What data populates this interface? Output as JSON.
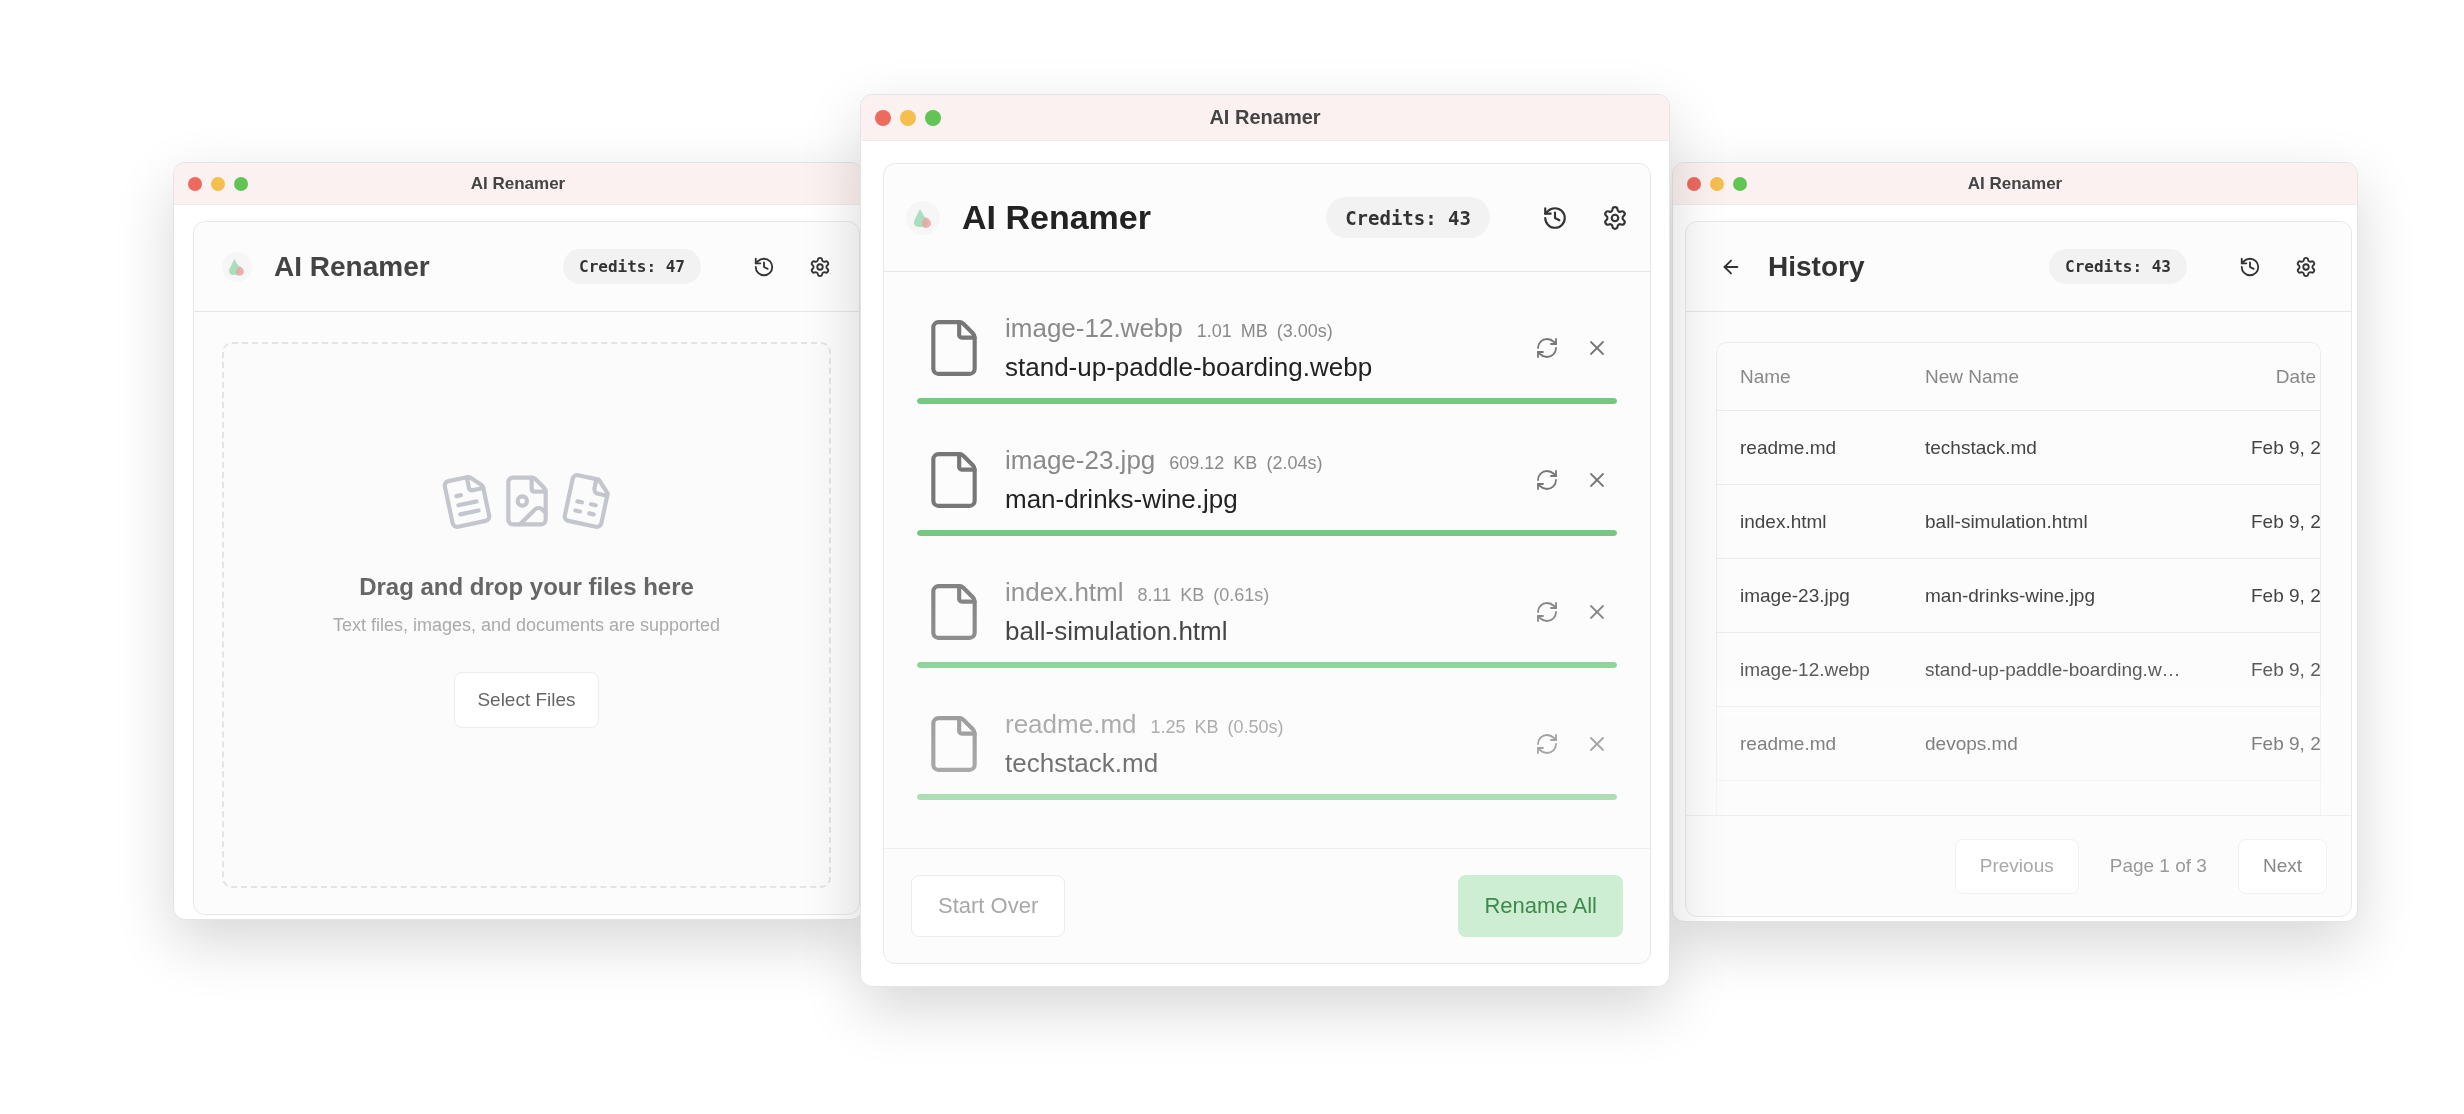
{
  "windows": [
    {
      "kind": "upload",
      "title": "AI Renamer",
      "app_name": "AI Renamer",
      "credits": "Credits: 47",
      "dropzone": {
        "heading": "Drag and drop your files here",
        "subtext": "Text files, images, and documents are supported",
        "button": "Select Files"
      }
    },
    {
      "kind": "rename",
      "title": "AI Renamer",
      "app_name": "AI Renamer",
      "credits": "Credits: 43",
      "files": [
        {
          "original": "image-12.webp",
          "meta": "1.01 MB (3.00s)",
          "new_name": "stand-up-paddle-boarding.webp",
          "level": 1
        },
        {
          "original": "image-23.jpg",
          "meta": "609.12 KB (2.04s)",
          "new_name": "man-drinks-wine.jpg",
          "level": 1
        },
        {
          "original": "index.html",
          "meta": "8.11 KB (0.61s)",
          "new_name": "ball-simulation.html",
          "level": 1
        },
        {
          "original": "readme.md",
          "meta": "1.25 KB (0.50s)",
          "new_name": "techstack.md",
          "level": 1
        }
      ],
      "buttons": [
        {
          "kind": "secondary",
          "label": "Start Over",
          "disabled": true
        },
        {
          "kind": "primary",
          "label": "Rename All",
          "disabled": true
        }
      ]
    },
    {
      "kind": "history",
      "title": "AI Renamer",
      "page_title": "History",
      "credits": "Credits: 43",
      "table": {
        "columns": [
          "Name",
          "New Name",
          "Date"
        ],
        "rows": [
          [
            "readme.md",
            "techstack.md",
            "Feb 9, 2"
          ],
          [
            "index.html",
            "ball-simulation.html",
            "Feb 9, 2"
          ],
          [
            "image-23.jpg",
            "man-drinks-wine.jpg",
            "Feb 9, 2"
          ],
          [
            "image-12.webp",
            "stand-up-paddle-boarding.w…",
            "Feb 9, 2"
          ],
          [
            "readme.md",
            "devops.md",
            "Feb 9, 2"
          ]
        ]
      },
      "pagination": {
        "previous": {
          "label": "Previous",
          "disabled": true
        },
        "page": "Page 1 of 3",
        "next": {
          "label": "Next",
          "disabled": false
        }
      }
    }
  ]
}
